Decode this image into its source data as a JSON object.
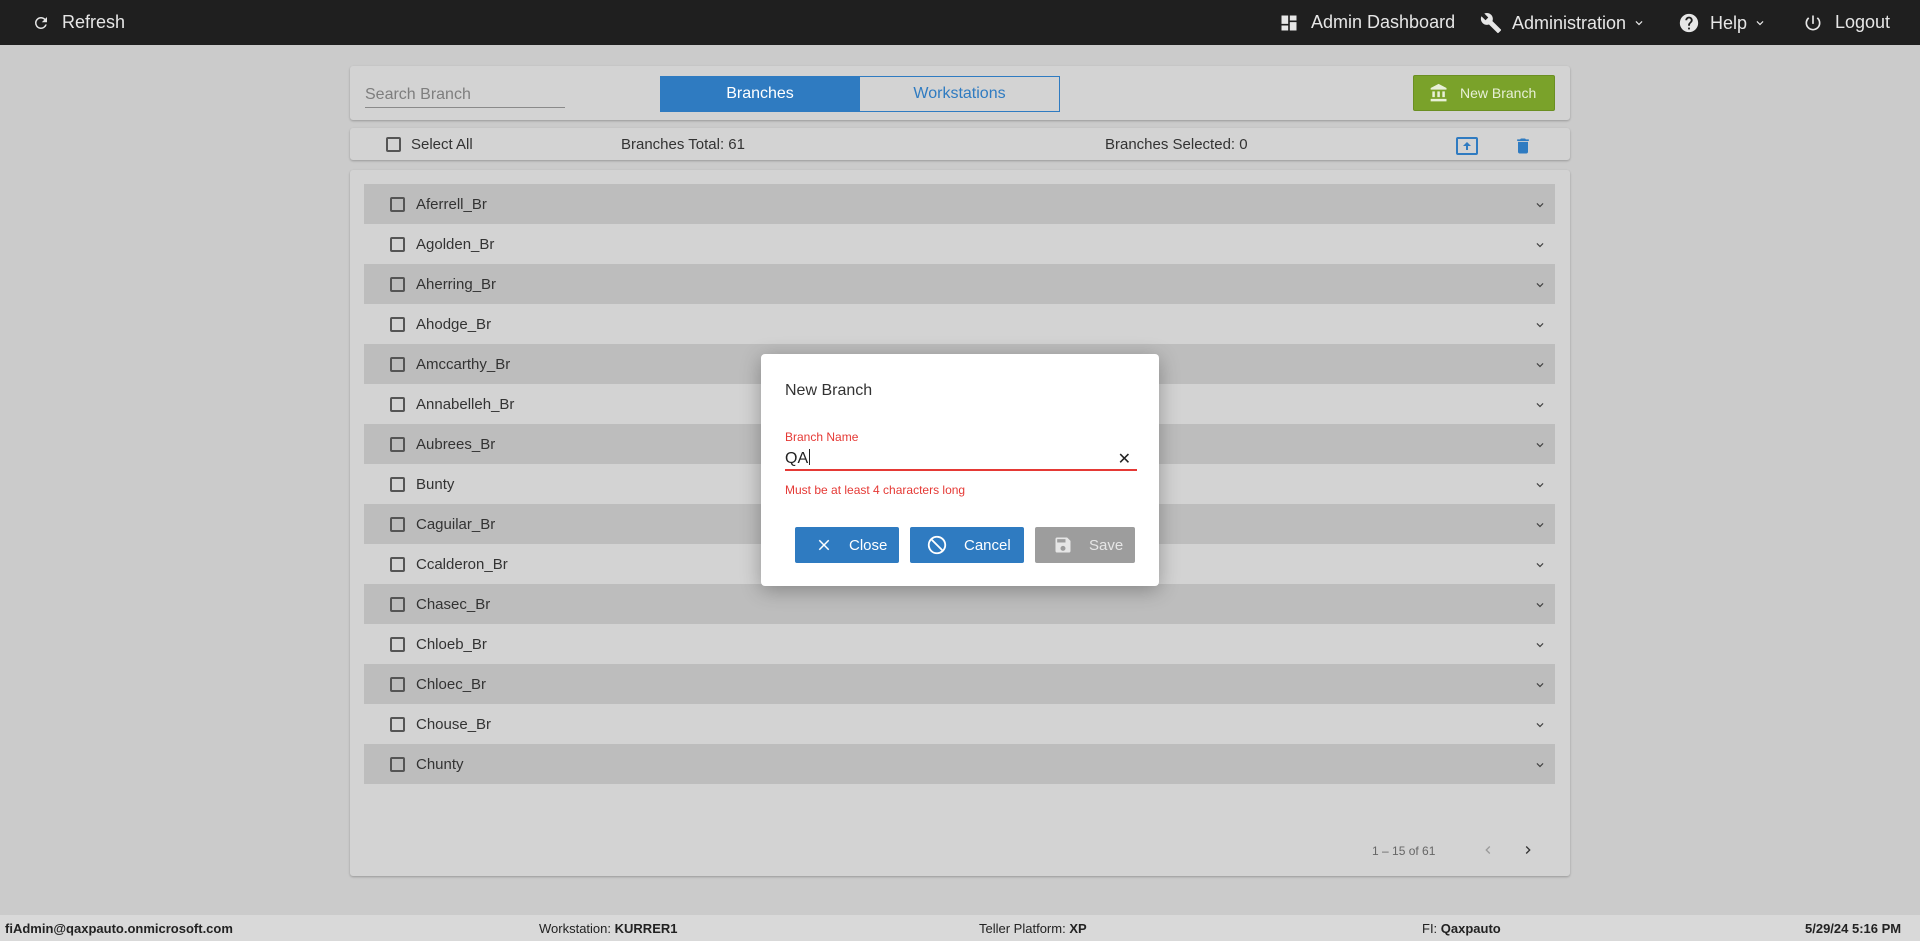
{
  "topbar": {
    "refresh_label": "Refresh",
    "admin_dashboard_label": "Admin Dashboard",
    "administration_label": "Administration",
    "help_label": "Help",
    "logout_label": "Logout"
  },
  "header": {
    "search_placeholder": "Search Branch",
    "tabs": [
      {
        "label": "Branches",
        "active": true
      },
      {
        "label": "Workstations",
        "active": false
      }
    ],
    "new_branch_label": "New Branch",
    "new_branch_color": "#7aa22a"
  },
  "summary": {
    "select_all_label": "Select All",
    "total_text": "Branches Total: 61",
    "selected_text": "Branches Selected: 0"
  },
  "branches": [
    {
      "name": "Aferrell_Br"
    },
    {
      "name": "Agolden_Br"
    },
    {
      "name": "Aherring_Br"
    },
    {
      "name": "Ahodge_Br"
    },
    {
      "name": "Amccarthy_Br"
    },
    {
      "name": "Annabelleh_Br"
    },
    {
      "name": "Aubrees_Br"
    },
    {
      "name": "Bunty"
    },
    {
      "name": "Caguilar_Br"
    },
    {
      "name": "Ccalderon_Br"
    },
    {
      "name": "Chasec_Br"
    },
    {
      "name": "Chloeb_Br"
    },
    {
      "name": "Chloec_Br"
    },
    {
      "name": "Chouse_Br"
    },
    {
      "name": "Chunty"
    }
  ],
  "pagination": {
    "range_text": "1 – 15 of 61"
  },
  "dialog": {
    "title": "New Branch",
    "field_label": "Branch Name",
    "field_value": "QA",
    "error_text": "Must be at least 4 characters long",
    "close_label": "Close",
    "cancel_label": "Cancel",
    "save_label": "Save",
    "error_color": "#e53935",
    "primary_color": "#2f7bc1"
  },
  "footer": {
    "user": "fiAdmin@qaxpauto.onmicrosoft.com",
    "workstation_label": "Workstation:",
    "workstation_value": "KURRER1",
    "platform_label": "Teller Platform:",
    "platform_value": "XP",
    "fi_label": "FI:",
    "fi_value": "Qaxpauto",
    "datetime": "5/29/24 5:16 PM"
  }
}
